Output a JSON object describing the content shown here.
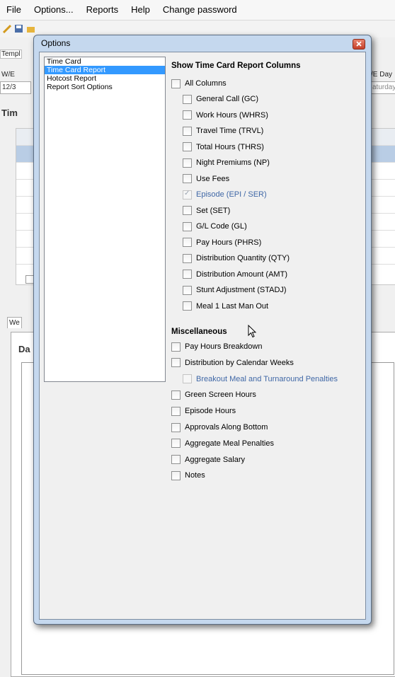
{
  "menubar": {
    "items": [
      "File",
      "Options...",
      "Reports",
      "Help",
      "Change password"
    ]
  },
  "background": {
    "tab_fragment": "Templ",
    "we_label": "W/E",
    "we_value": "12/3",
    "we_day_label": "/E Day",
    "we_day_value": "aturday",
    "section_heading": "Tim",
    "lower_tab": "We",
    "lower_heading": "Da"
  },
  "dialog": {
    "title": "Options",
    "nav_items": [
      {
        "label": "Time Card",
        "selected": false
      },
      {
        "label": "Time Card Report",
        "selected": true
      },
      {
        "label": "Hotcost Report",
        "selected": false
      },
      {
        "label": "Report Sort Options",
        "selected": false
      }
    ],
    "columns_section": {
      "title": "Show Time Card Report Columns",
      "all_columns": {
        "label": "All Columns",
        "checked": false
      },
      "options": [
        {
          "label": "General Call (GC)",
          "checked": false,
          "enabled": true
        },
        {
          "label": "Work Hours (WHRS)",
          "checked": false,
          "enabled": true
        },
        {
          "label": "Travel Time (TRVL)",
          "checked": false,
          "enabled": true
        },
        {
          "label": "Total Hours (THRS)",
          "checked": false,
          "enabled": true
        },
        {
          "label": "Night Premiums (NP)",
          "checked": false,
          "enabled": true
        },
        {
          "label": "Use Fees",
          "checked": false,
          "enabled": true
        },
        {
          "label": "Episode (EPI / SER)",
          "checked": true,
          "enabled": false
        },
        {
          "label": "Set (SET)",
          "checked": false,
          "enabled": true
        },
        {
          "label": "G/L Code (GL)",
          "checked": false,
          "enabled": true
        },
        {
          "label": "Pay Hours (PHRS)",
          "checked": false,
          "enabled": true
        },
        {
          "label": "Distribution Quantity (QTY)",
          "checked": false,
          "enabled": true
        },
        {
          "label": "Distribution Amount (AMT)",
          "checked": false,
          "enabled": true
        },
        {
          "label": "Stunt Adjustment (STADJ)",
          "checked": false,
          "enabled": true
        },
        {
          "label": "Meal 1 Last Man Out",
          "checked": false,
          "enabled": true
        }
      ]
    },
    "misc_section": {
      "title": "Miscellaneous",
      "options": [
        {
          "label": "Pay Hours Breakdown",
          "checked": false,
          "enabled": true,
          "indent": false
        },
        {
          "label": "Distribution by Calendar Weeks",
          "checked": false,
          "enabled": true,
          "indent": false
        },
        {
          "label": "Breakout Meal and Turnaround Penalties",
          "checked": false,
          "enabled": false,
          "indent": true
        },
        {
          "label": "Green Screen Hours",
          "checked": false,
          "enabled": true,
          "indent": false
        },
        {
          "label": "Episode Hours",
          "checked": false,
          "enabled": true,
          "indent": false
        },
        {
          "label": "Approvals Along Bottom",
          "checked": false,
          "enabled": true,
          "indent": false
        },
        {
          "label": "Aggregate Meal Penalties",
          "checked": false,
          "enabled": true,
          "indent": false
        },
        {
          "label": "Aggregate Salary",
          "checked": false,
          "enabled": true,
          "indent": false
        },
        {
          "label": "Notes",
          "checked": false,
          "enabled": true,
          "indent": false
        }
      ]
    }
  },
  "icons": {
    "close": "close-icon",
    "cursor": "mouse-pointer-icon"
  },
  "colors": {
    "selection": "#3399ff",
    "dialog_frame": "#c5d8ee",
    "disabled_text": "#3f67a6"
  }
}
